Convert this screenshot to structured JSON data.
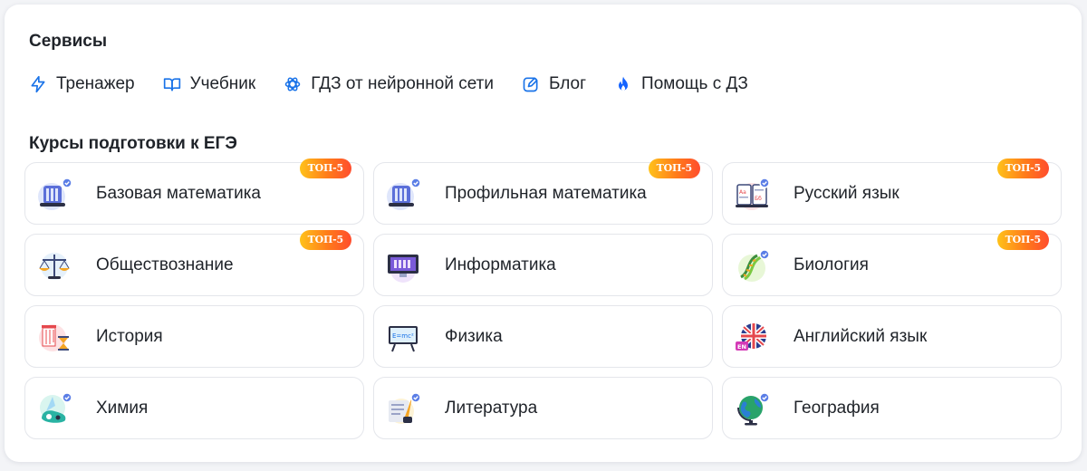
{
  "services": {
    "title": "Сервисы",
    "items": [
      {
        "label": "Тренажер",
        "icon": "lightning-icon"
      },
      {
        "label": "Учебник",
        "icon": "book-open-icon"
      },
      {
        "label": "ГДЗ от нейронной сети",
        "icon": "neural-network-icon"
      },
      {
        "label": "Блог",
        "icon": "edit-icon"
      },
      {
        "label": "Помощь с ДЗ",
        "icon": "fire-icon"
      }
    ]
  },
  "courses": {
    "title": "Курсы подготовки к ЕГЭ",
    "badge_label": "ТОП-5",
    "items": [
      {
        "label": "Базовая математика",
        "icon": "server-math-icon",
        "top5": true
      },
      {
        "label": "Профильная математика",
        "icon": "server-math-icon",
        "top5": true
      },
      {
        "label": "Русский язык",
        "icon": "alphabet-book-icon",
        "top5": true
      },
      {
        "label": "Обществознание",
        "icon": "scales-icon",
        "top5": true
      },
      {
        "label": "Информатика",
        "icon": "monitor-icon",
        "top5": false
      },
      {
        "label": "Биология",
        "icon": "dna-icon",
        "top5": true
      },
      {
        "label": "История",
        "icon": "column-hourglass-icon",
        "top5": false
      },
      {
        "label": "Физика",
        "icon": "blackboard-formula-icon",
        "top5": false
      },
      {
        "label": "Английский язык",
        "icon": "uk-flag-icon",
        "top5": false
      },
      {
        "label": "Химия",
        "icon": "flask-icon",
        "top5": false
      },
      {
        "label": "Литература",
        "icon": "quill-book-icon",
        "top5": false
      },
      {
        "label": "География",
        "icon": "globe-icon",
        "top5": false
      }
    ]
  },
  "colors": {
    "accent_blue": "#1a73e8",
    "badge_gradient_start": "#ffc21a",
    "badge_gradient_end": "#ff4d2e",
    "fire_blue": "#1463ff"
  }
}
